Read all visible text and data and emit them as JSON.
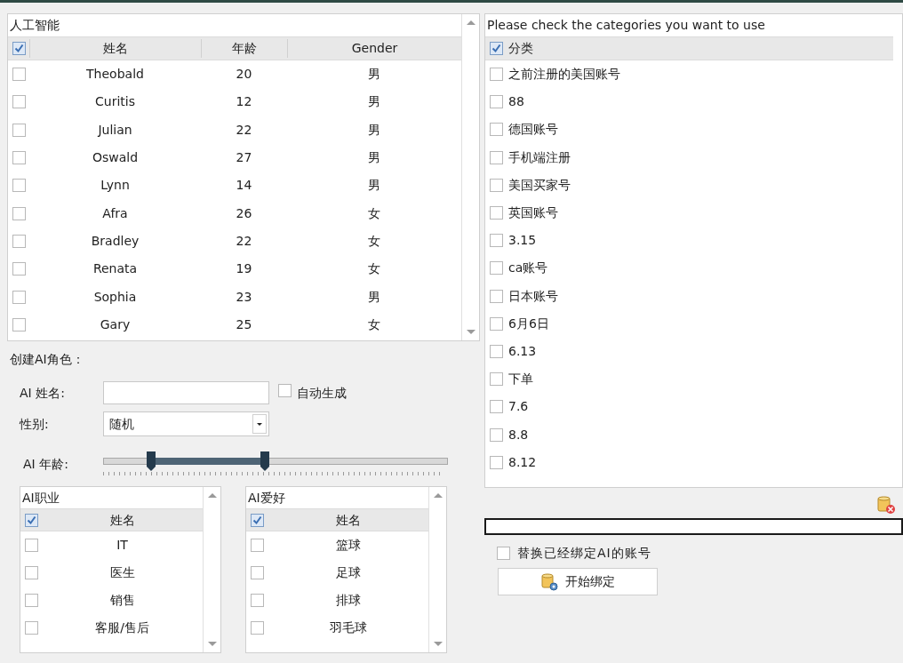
{
  "ai_table": {
    "title": "人工智能",
    "header_checked": true,
    "columns": [
      "姓名",
      "年龄",
      "Gender"
    ],
    "rows": [
      {
        "checked": false,
        "cells": [
          "Theobald",
          "20",
          "男"
        ]
      },
      {
        "checked": false,
        "cells": [
          "Curitis",
          "12",
          "男"
        ]
      },
      {
        "checked": false,
        "cells": [
          "Julian",
          "22",
          "男"
        ]
      },
      {
        "checked": false,
        "cells": [
          "Oswald",
          "27",
          "男"
        ]
      },
      {
        "checked": false,
        "cells": [
          "Lynn",
          "14",
          "男"
        ]
      },
      {
        "checked": false,
        "cells": [
          "Afra",
          "26",
          "女"
        ]
      },
      {
        "checked": false,
        "cells": [
          "Bradley",
          "22",
          "女"
        ]
      },
      {
        "checked": false,
        "cells": [
          "Renata",
          "19",
          "女"
        ]
      },
      {
        "checked": false,
        "cells": [
          "Sophia",
          "23",
          "男"
        ]
      },
      {
        "checked": false,
        "cells": [
          "Gary",
          "25",
          "女"
        ]
      }
    ]
  },
  "create": {
    "title": "创建AI角色：",
    "name_label": "AI 姓名:",
    "auto_label": "自动生成",
    "auto_checked": false,
    "gender_label": "性别:",
    "gender_value": "随机",
    "age_label": "AI 年龄:",
    "age_thumbs": [
      {
        "level": 0.14
      },
      {
        "level": 0.47
      }
    ]
  },
  "sublists": [
    {
      "title": "AI职业",
      "header_checked": true,
      "column": "姓名",
      "items": [
        {
          "label": "IT",
          "checked": false
        },
        {
          "label": "医生",
          "checked": false
        },
        {
          "label": "销售",
          "checked": false
        },
        {
          "label": "客服/售后",
          "checked": false
        }
      ]
    },
    {
      "title": "AI爱好",
      "header_checked": true,
      "column": "姓名",
      "items": [
        {
          "label": "篮球",
          "checked": false
        },
        {
          "label": "足球",
          "checked": false
        },
        {
          "label": "排球",
          "checked": false
        },
        {
          "label": "羽毛球",
          "checked": false
        }
      ]
    }
  ],
  "categories": {
    "title": "Please check the categories you want to use",
    "header": "分类",
    "header_checked": true,
    "items": [
      {
        "label": "之前注册的美国账号",
        "checked": false
      },
      {
        "label": "88",
        "checked": false
      },
      {
        "label": "德国账号",
        "checked": false
      },
      {
        "label": "手机端注册",
        "checked": false
      },
      {
        "label": "美国买家号",
        "checked": false
      },
      {
        "label": "英国账号",
        "checked": false
      },
      {
        "label": "3.15",
        "checked": false
      },
      {
        "label": "ca账号",
        "checked": false
      },
      {
        "label": "日本账号",
        "checked": false
      },
      {
        "label": "6月6日",
        "checked": false
      },
      {
        "label": "6.13",
        "checked": false
      },
      {
        "label": "下单",
        "checked": false
      },
      {
        "label": "7.6",
        "checked": false
      },
      {
        "label": "8.8",
        "checked": false
      },
      {
        "label": "8.12",
        "checked": false
      }
    ]
  },
  "progress": {
    "level": 0
  },
  "replace": {
    "label": "替换已经绑定AI的账号",
    "checked": false
  },
  "bind_button": "开始绑定"
}
